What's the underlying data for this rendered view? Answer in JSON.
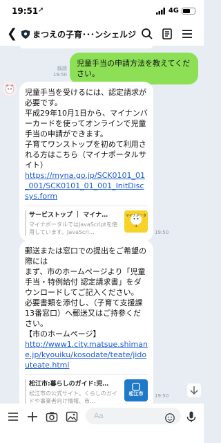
{
  "status": {
    "time": "19:51",
    "network": "4G"
  },
  "header": {
    "title": "まつえの子育･･･ンシェルジュ"
  },
  "messages": {
    "user": {
      "text": "児童手当の申請方法を教えてください。",
      "read": "既読",
      "time": "19:50"
    },
    "bot1": {
      "text": "児童手当を受けるには、認定請求が必要です。\n平成29年10月1日から、マイナンバーカードを使ってオンラインで児童手当の申請ができます。\n子育てワンストップを初めて利用される方はこちら（マイナポータルサイト）",
      "link": "https://myna.go.jp/SCK0101_01_001/SCK0101_01_001_InitDiscsys.form",
      "card_title": "サービストップ ｜ マイナ…",
      "card_desc": "マイナポータルではJavaScriptを使用しています。JavaScri…",
      "card_thumb_label": "マイナポータル",
      "time": "19:50"
    },
    "bot2": {
      "text": "郵送または窓口での提出をご希望の際には\nまず、市のホームページより「児童手当・特例給付 認定請求書」をダウンロードしてご記入ください。\n必要書類を添付し、（子育て支援課13番窓口）へ郵送又はご持参ください。\n【市のホームページ】",
      "link": "http://www1.city.matsue.shimane.jp/kyouiku/kosodate/teate/jidouteate.html",
      "card_title": "松江市:暮らしのガイド:児…",
      "card_desc": "松江市の公式サイト。くらしのガイドや事業者向け情報、市…",
      "card_thumb_label": "松江市",
      "time": "19:50"
    }
  },
  "input": {
    "placeholder": "Aa"
  },
  "colors": {
    "user_bubble": "#8de055",
    "chat_bg": "#e7edf3",
    "link": "#1a5bd6"
  }
}
